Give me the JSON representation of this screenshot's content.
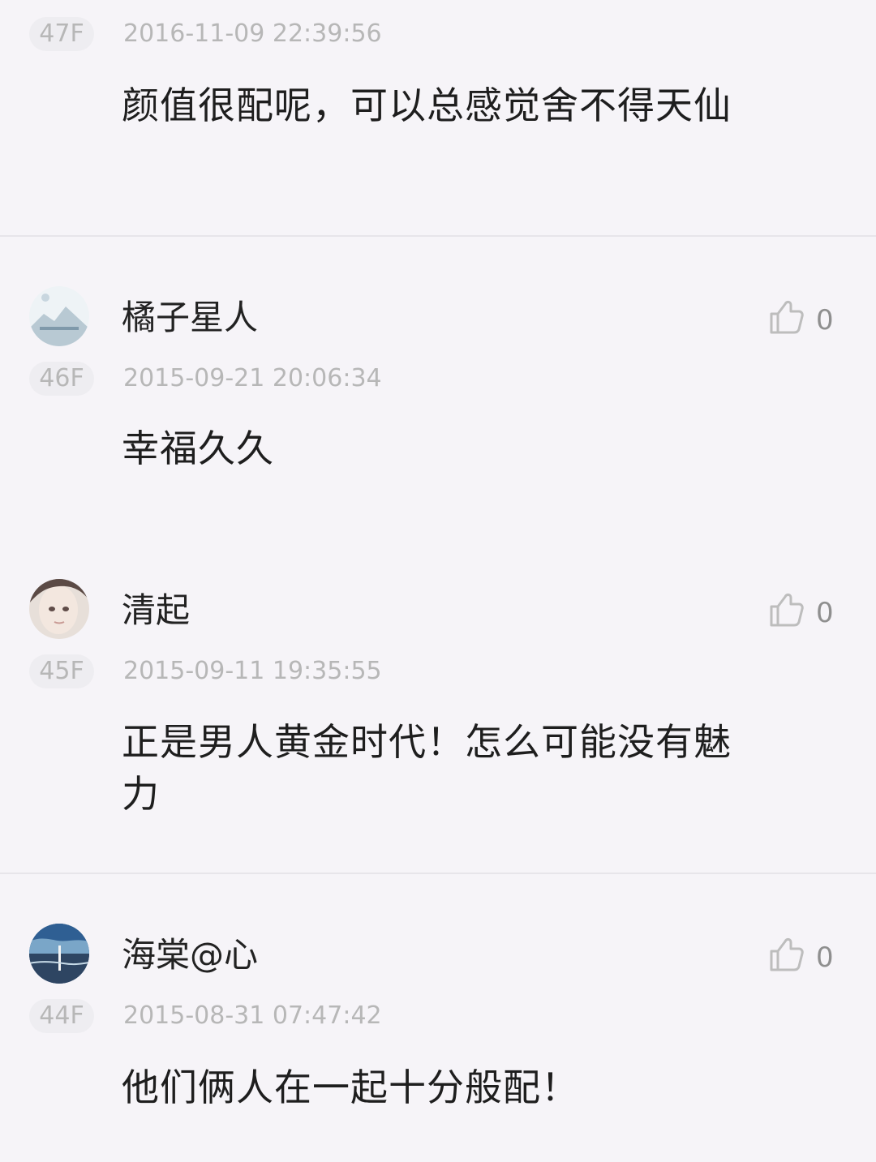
{
  "comments": [
    {
      "floor": "47F",
      "time": "2016-11-09 22:39:56",
      "content": "颜值很配呢，可以总感觉舍不得天仙"
    },
    {
      "username": "橘子星人",
      "like_count": "0",
      "floor": "46F",
      "time": "2015-09-21 20:06:34",
      "content": "幸福久久"
    },
    {
      "username": "清起",
      "like_count": "0",
      "floor": "45F",
      "time": "2015-09-11 19:35:55",
      "content": "正是男人黄金时代！怎么可能没有魅力"
    },
    {
      "username": "海棠@心",
      "like_count": "0",
      "floor": "44F",
      "time": "2015-08-31 07:47:42",
      "content": "他们俩人在一起十分般配！"
    }
  ],
  "icons": {
    "like": "thumbs-up-icon"
  },
  "colors": {
    "background": "#f6f4f8",
    "muted_text": "#b7b7b7",
    "primary_text": "#1e1e1e",
    "divider": "#e7e5ea"
  }
}
